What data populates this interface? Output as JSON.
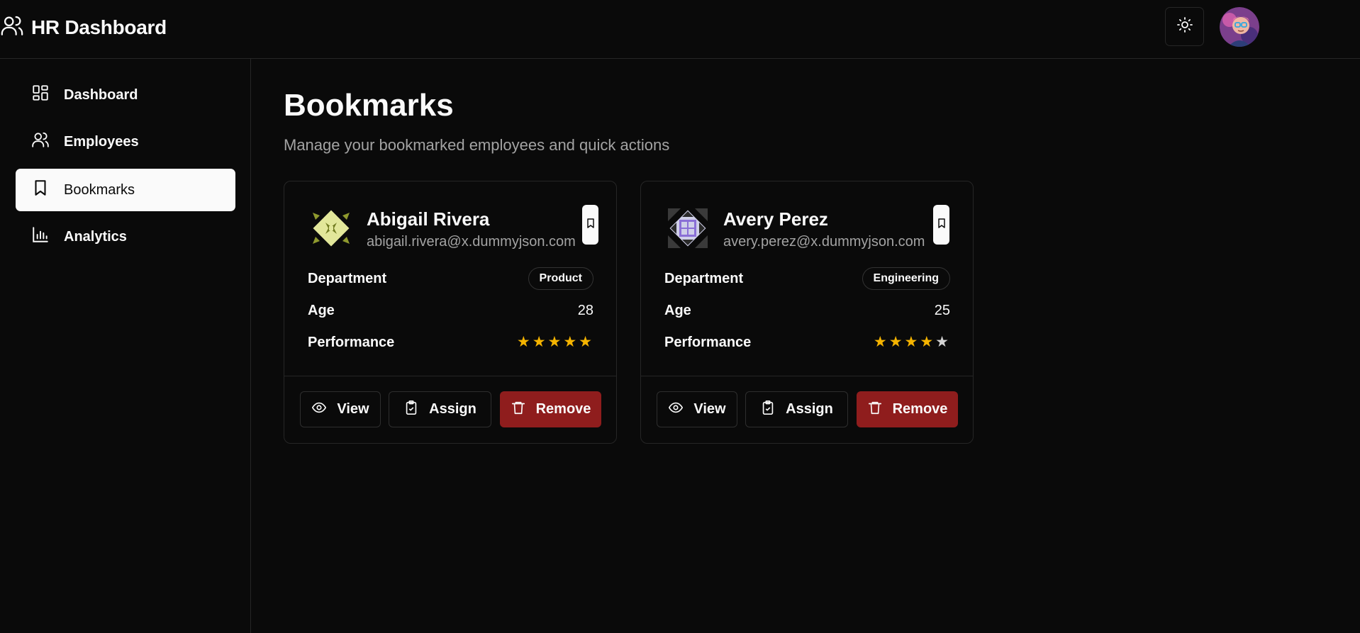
{
  "header": {
    "title": "HR Dashboard"
  },
  "sidebar": {
    "items": [
      {
        "label": "Dashboard",
        "icon": "dashboard-icon"
      },
      {
        "label": "Employees",
        "icon": "users-icon"
      },
      {
        "label": "Bookmarks",
        "icon": "bookmark-icon",
        "active": true
      },
      {
        "label": "Analytics",
        "icon": "bar-chart-icon"
      }
    ]
  },
  "page": {
    "title": "Bookmarks",
    "subtitle": "Manage your bookmarked employees and quick actions"
  },
  "labels": {
    "department": "Department",
    "age": "Age",
    "performance": "Performance",
    "view": "View",
    "assign": "Assign",
    "remove": "Remove"
  },
  "employees": [
    {
      "name": "Abigail Rivera",
      "email": "abigail.rivera@x.dummyjson.com",
      "department": "Product",
      "age": "28",
      "rating": 5,
      "rating_max": 5
    },
    {
      "name": "Avery Perez",
      "email": "avery.perez@x.dummyjson.com",
      "department": "Engineering",
      "age": "25",
      "rating": 4,
      "rating_max": 5
    }
  ],
  "colors": {
    "star_filled": "#f5b400",
    "star_empty": "#d4d4d4",
    "danger": "#8f1d1d"
  }
}
